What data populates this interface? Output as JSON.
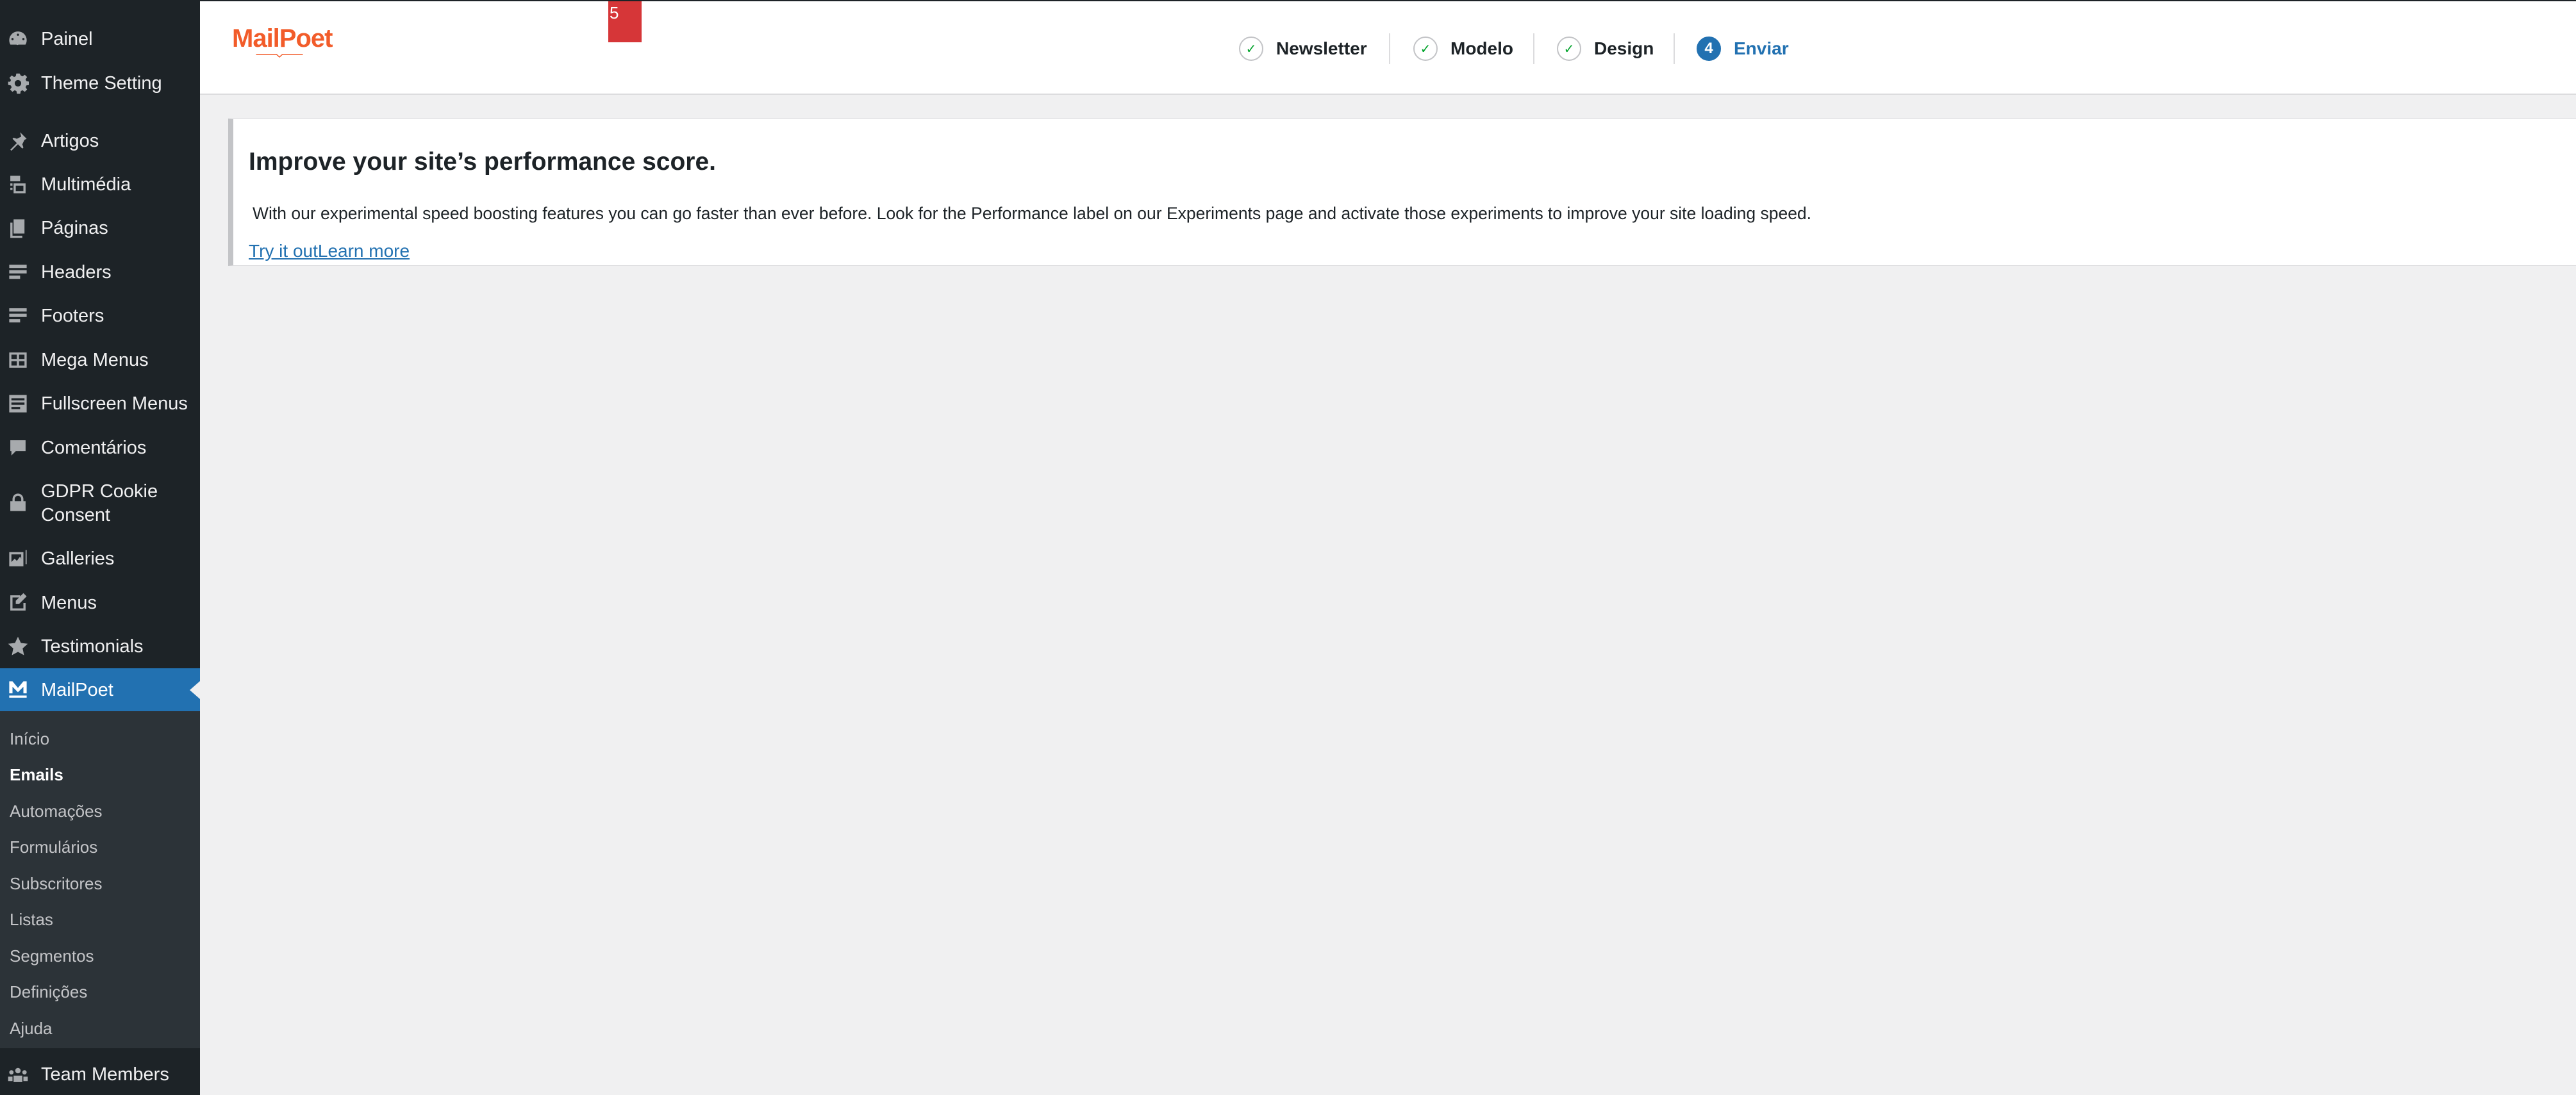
{
  "sidebar": {
    "items": [
      {
        "label": "Painel",
        "icon": "dashboard-icon"
      },
      {
        "label": "Theme Setting",
        "icon": "gear-icon"
      },
      {
        "label": "Artigos",
        "icon": "pushpin-icon"
      },
      {
        "label": "Multimédia",
        "icon": "media-icon"
      },
      {
        "label": "Páginas",
        "icon": "pages-icon"
      },
      {
        "label": "Headers",
        "icon": "layout-icon"
      },
      {
        "label": "Footers",
        "icon": "layout-icon"
      },
      {
        "label": "Mega Menus",
        "icon": "grid-layout-icon"
      },
      {
        "label": "Fullscreen Menus",
        "icon": "text-layout-icon"
      },
      {
        "label": "Comentários",
        "icon": "comment-icon"
      },
      {
        "label": "GDPR Cookie Consent",
        "icon": "lock-icon"
      },
      {
        "label": "Galleries",
        "icon": "gallery-icon"
      },
      {
        "label": "Menus",
        "icon": "edit-page-icon"
      },
      {
        "label": "Testimonials",
        "icon": "star-icon"
      },
      {
        "label": "MailPoet",
        "icon": "mailpoet-icon"
      },
      {
        "label": "Team Members",
        "icon": "groups-icon"
      }
    ],
    "submenu": [
      {
        "label": "Início"
      },
      {
        "label": "Emails"
      },
      {
        "label": "Automações"
      },
      {
        "label": "Formulários"
      },
      {
        "label": "Subscritores"
      },
      {
        "label": "Listas"
      },
      {
        "label": "Segmentos"
      },
      {
        "label": "Definições"
      },
      {
        "label": "Ajuda"
      }
    ],
    "active_item": "MailPoet",
    "current_submenu": "Emails"
  },
  "header": {
    "logo_text": "MailPoet",
    "badge_count": "5",
    "steps": [
      {
        "label": "Newsletter",
        "marker": "✓",
        "state": "done"
      },
      {
        "label": "Modelo",
        "marker": "✓",
        "state": "done"
      },
      {
        "label": "Design",
        "marker": "✓",
        "state": "done"
      },
      {
        "label": "Enviar",
        "marker": "4",
        "state": "current"
      }
    ]
  },
  "notice": {
    "title": "Improve your site’s performance score.",
    "body": "With our experimental speed boosting features you can go faster than ever before. Look for the Performance label on our Experiments page and activate those experiments to improve your site loading speed.",
    "link_try": "Try it out",
    "link_learn": "Learn more"
  },
  "colors": {
    "sidebar_bg": "#1d2327",
    "submenu_bg": "#2c3338",
    "accent": "#2271b1",
    "brand": "#f25c2a",
    "badge": "#d63638",
    "page_bg": "#f0f0f1"
  }
}
